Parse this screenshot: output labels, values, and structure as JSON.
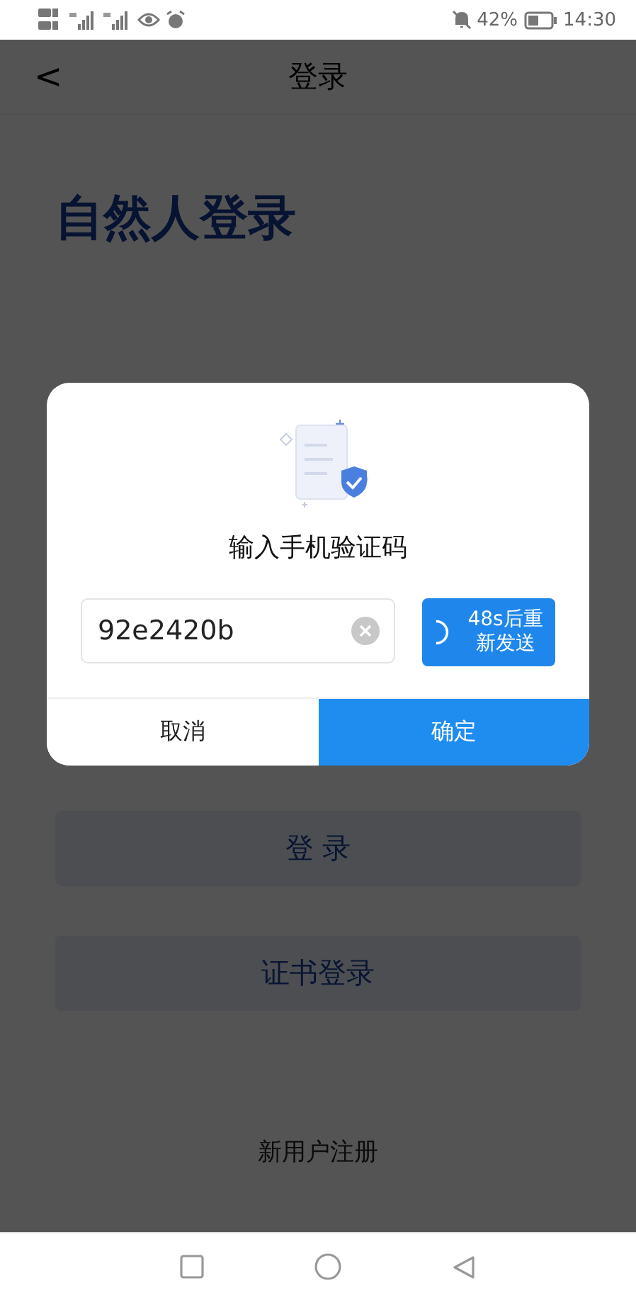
{
  "status_bar": {
    "battery": "42%",
    "time": "14:30"
  },
  "header": {
    "back": "<",
    "title": "登录"
  },
  "page": {
    "heading": "自然人登录",
    "buttons": [
      "登 录",
      "证书登录"
    ],
    "register_link": "新用户注册"
  },
  "dialog": {
    "title": "输入手机验证码",
    "code_field": {
      "value": "92e2420b"
    },
    "resend_button": {
      "label": "48s后重新发送"
    },
    "actions": [
      {
        "label": "取消",
        "kind": "secondary"
      },
      {
        "label": "确定",
        "kind": "primary"
      }
    ]
  }
}
